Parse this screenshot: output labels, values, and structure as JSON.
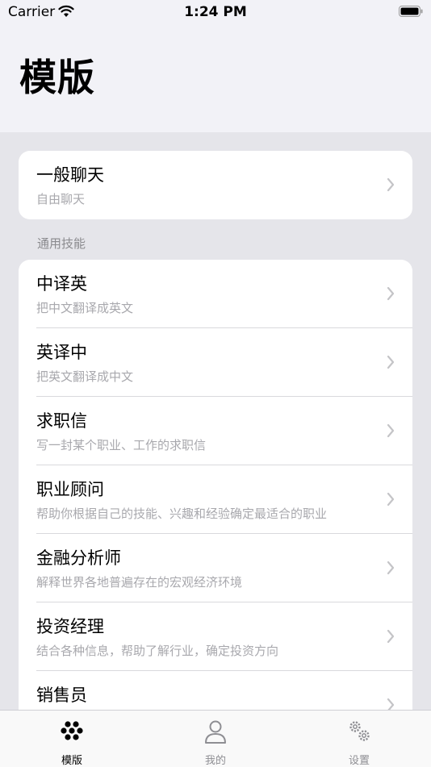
{
  "status": {
    "carrier": "Carrier",
    "time": "1:24 PM"
  },
  "header": {
    "title": "模版"
  },
  "general_card": {
    "title": "一般聊天",
    "subtitle": "自由聊天"
  },
  "section": {
    "header": "通用技能",
    "items": [
      {
        "title": "中译英",
        "subtitle": "把中文翻译成英文"
      },
      {
        "title": "英译中",
        "subtitle": "把英文翻译成中文"
      },
      {
        "title": "求职信",
        "subtitle": "写一封某个职业、工作的求职信"
      },
      {
        "title": "职业顾问",
        "subtitle": "帮助你根据自己的技能、兴趣和经验确定最适合的职业"
      },
      {
        "title": "金融分析师",
        "subtitle": "解释世界各地普遍存在的宏观经济环境"
      },
      {
        "title": "投资经理",
        "subtitle": "结合各种信息，帮助了解行业，确定投资方向"
      },
      {
        "title": "销售员",
        "subtitle": ""
      }
    ]
  },
  "tabs": [
    {
      "label": "模版",
      "icon": "templates-icon",
      "active": true
    },
    {
      "label": "我的",
      "icon": "person-icon",
      "active": false
    },
    {
      "label": "设置",
      "icon": "gears-icon",
      "active": false
    }
  ],
  "colors": {
    "active_tab": "#000000",
    "inactive_tab": "#8e8e93",
    "group_bg": "#e5e5ea"
  }
}
